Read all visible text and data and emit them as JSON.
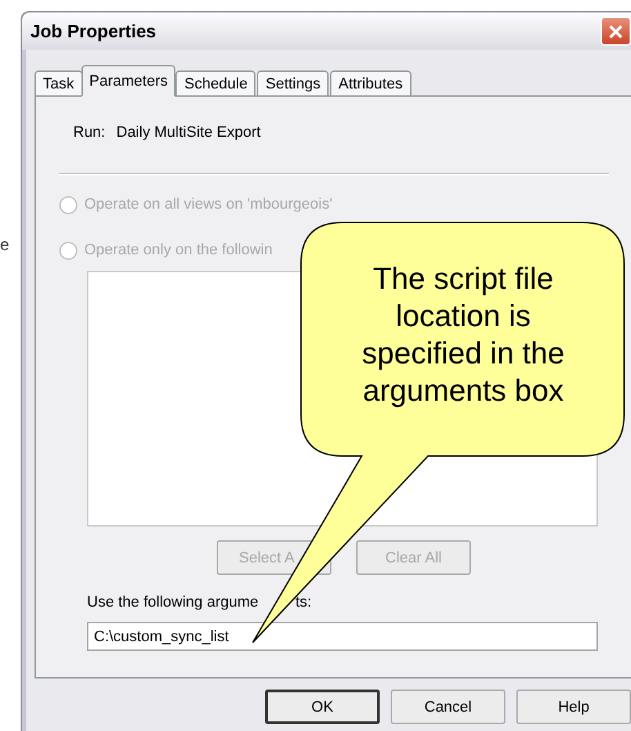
{
  "background_text": "e",
  "window": {
    "title": "Job Properties"
  },
  "tabs": [
    {
      "label": "Task",
      "selected": false
    },
    {
      "label": "Parameters",
      "selected": true
    },
    {
      "label": "Schedule",
      "selected": false
    },
    {
      "label": "Settings",
      "selected": false
    },
    {
      "label": "Attributes",
      "selected": false
    }
  ],
  "run": {
    "label": "Run:",
    "value": "Daily MultiSite Export"
  },
  "radios": [
    {
      "label": "Operate on all views on 'mbourgeois'",
      "selected": false,
      "disabled": true
    },
    {
      "label": "Operate only on the followin",
      "selected": false,
      "disabled": true
    }
  ],
  "list_buttons": [
    {
      "label": "Select A",
      "disabled": true
    },
    {
      "label": "Clear All",
      "disabled": true
    }
  ],
  "arguments": {
    "label": "Use the following argume",
    "label_tail": "ts:",
    "value": "C:\\custom_sync_list"
  },
  "buttons": [
    {
      "label": "OK",
      "default": true
    },
    {
      "label": "Cancel",
      "default": false
    },
    {
      "label": "Help",
      "default": false
    }
  ],
  "callout": {
    "text": "The script file location is specified in the arguments box"
  }
}
